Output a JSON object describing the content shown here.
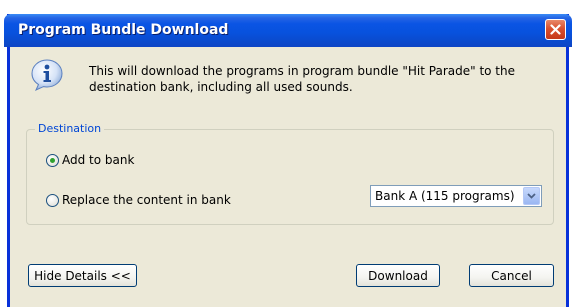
{
  "dialog": {
    "title": "Program Bundle Download",
    "message": "This will download the programs in program bundle \"Hit Parade\" to the destination bank, including all used sounds."
  },
  "destination": {
    "legend": "Destination",
    "option_add": "Add to bank",
    "option_replace": "Replace the content in bank",
    "selected_option": "Add to bank",
    "bank_select_value": "Bank A (115 programs)"
  },
  "buttons": {
    "hide_details": "Hide Details <<",
    "download": "Download",
    "cancel": "Cancel"
  },
  "icons": {
    "info": "info-icon",
    "close": "close-icon",
    "dropdown": "chevron-down-icon"
  },
  "colors": {
    "titlebar": "#0a54e4",
    "dialog_bg": "#ece9d8",
    "close_button": "#d9502f",
    "legend_text": "#0046d5"
  }
}
